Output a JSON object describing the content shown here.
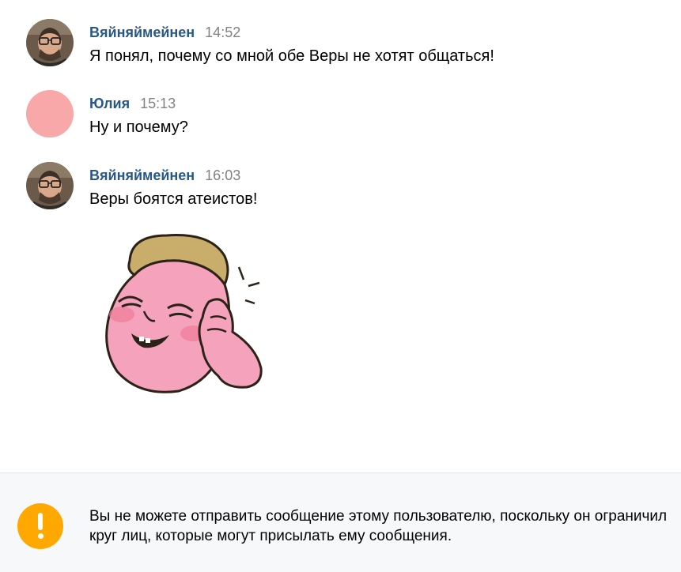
{
  "messages": [
    {
      "author": "Вяйняймейнен",
      "time": "14:52",
      "text": "Я понял, почему со мной обе Веры не хотят общаться!"
    },
    {
      "author": "Юлия",
      "time": "15:13",
      "text": "Ну и почему?"
    },
    {
      "author": "Вяйняймейнен",
      "time": "16:03",
      "text": "Веры боятся атеистов!"
    }
  ],
  "sticker": {
    "icon": "laughing-pink-face-sticker"
  },
  "footer": {
    "icon": "warning-icon",
    "notice": "Вы не можете отправить сообщение этому пользователю, поскольку он ограничил круг лиц, которые могут присылать ему сообщения."
  },
  "colors": {
    "author": "#2a5885",
    "time": "#828282",
    "warning": "#ffa800",
    "footer_bg": "#f7f8fa",
    "avatar_pink": "#f8a8a8"
  }
}
